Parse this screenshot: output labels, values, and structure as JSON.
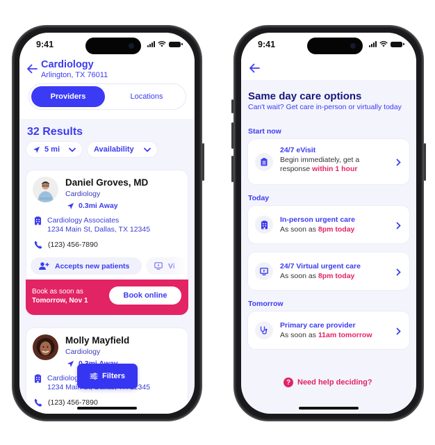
{
  "status_bar": {
    "time": "9:41"
  },
  "providers_screen": {
    "header": {
      "title": "Cardiology",
      "location": "Arlington, TX 76011"
    },
    "tabs": [
      {
        "label": "Providers",
        "active": true
      },
      {
        "label": "Locations",
        "active": false
      }
    ],
    "results_title": "32 Results",
    "filter_chips": [
      {
        "icon": "navigation-arrow-icon",
        "label": "5 mi"
      },
      {
        "label": "Availability"
      }
    ],
    "providers": [
      {
        "name": "Daniel Groves, MD",
        "specialty": "Cardiology",
        "distance": "0.3mi Away",
        "practice": "Cardiology Associates",
        "address": "1234 Main St, Dallas, TX 12345",
        "phone": "(123) 456-7890",
        "tags": [
          "Accepts new patients",
          "Vi"
        ],
        "booking": {
          "label": "Book as soon as",
          "date": "Tomorrow, Nov 1",
          "button": "Book online"
        }
      },
      {
        "name": "Molly Mayfield",
        "specialty": "Cardiology",
        "distance": "0.3mi Away",
        "practice": "Cardiology Associates",
        "address": "1234 Main St, Dallas, TX 12345",
        "phone": "(123) 456-7890"
      }
    ],
    "filters_button": "Filters"
  },
  "care_screen": {
    "title": "Same day care options",
    "subtitle": "Can't wait? Get care in-person or virtually today",
    "sections": [
      {
        "label": "Start now",
        "options": [
          {
            "icon": "clipboard-icon",
            "title": "24/7 eVisit",
            "desc_prefix": "Begin immediately, get a response ",
            "highlight": "within 1 hour"
          }
        ]
      },
      {
        "label": "Today",
        "options": [
          {
            "icon": "hospital-icon",
            "title": "In-person urgent care",
            "desc_prefix": "As soon as ",
            "highlight": "8pm today"
          },
          {
            "icon": "video-screen-icon",
            "title": "24/7 Virtual urgent care",
            "desc_prefix": "As soon as ",
            "highlight": "8pm today"
          }
        ]
      },
      {
        "label": "Tomorrow",
        "options": [
          {
            "icon": "stethoscope-icon",
            "title": "Primary care provider",
            "desc_prefix": "As soon as ",
            "highlight": "11am tomorrow"
          }
        ]
      }
    ],
    "help_link": "Need help deciding?"
  },
  "colors": {
    "primary": "#3b3bf6",
    "accent_pink": "#e22464",
    "title_navy": "#17177a",
    "background": "#f4f4fd"
  }
}
